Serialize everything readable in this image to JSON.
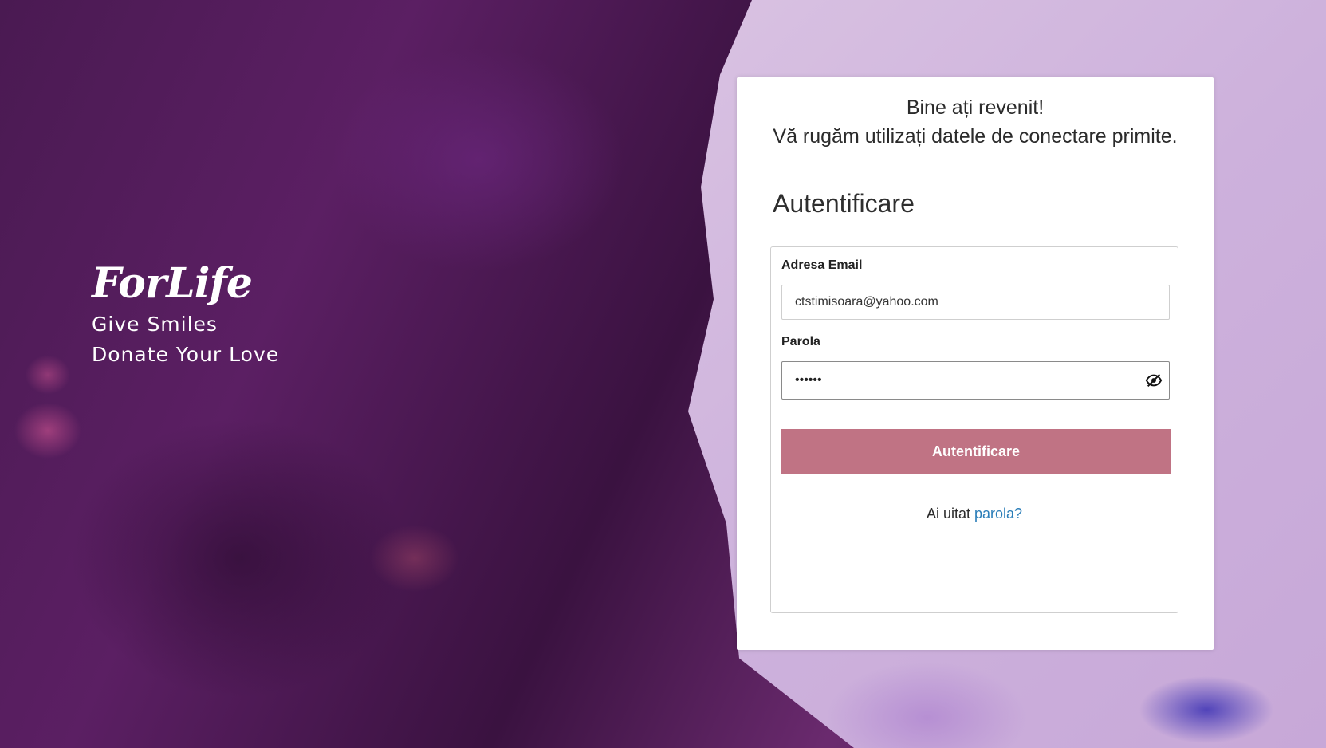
{
  "brand": {
    "logo": "ForLife",
    "tagline_1": "Give Smiles",
    "tagline_2": "Donate Your Love"
  },
  "panel": {
    "welcome_line_1": "Bine ați revenit!",
    "welcome_line_2": "Vă rugăm utilizați datele de conectare primite.",
    "title": "Autentificare"
  },
  "form": {
    "email_label": "Adresa Email",
    "email_value": "ctstimisoara@yahoo.com",
    "password_label": "Parola",
    "password_value": "••••••",
    "submit_label": "Autentificare",
    "forgot_prefix": "Ai uitat",
    "forgot_link": "parola?"
  },
  "icons": {
    "password_toggle": "eye-off-icon"
  },
  "colors": {
    "button": "#c07384",
    "link": "#2a7db8"
  }
}
